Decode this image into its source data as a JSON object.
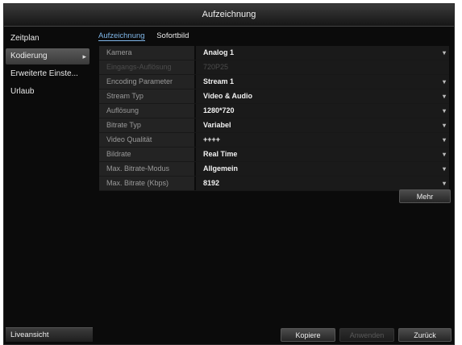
{
  "window": {
    "title": "Aufzeichnung"
  },
  "sidebar": {
    "items": [
      {
        "label": "Zeitplan",
        "active": false
      },
      {
        "label": "Kodierung",
        "active": true
      },
      {
        "label": "Erweiterte Einste...",
        "active": false
      },
      {
        "label": "Urlaub",
        "active": false
      }
    ],
    "live_view_label": "Liveansicht"
  },
  "tabs": [
    {
      "label": "Aufzeichnung",
      "active": true
    },
    {
      "label": "Sofortbild",
      "active": false
    }
  ],
  "settings": [
    {
      "label": "Kamera",
      "value": "Analog 1",
      "dropdown": true,
      "disabled": false
    },
    {
      "label": "Eingangs-Auflösung",
      "value": "720P25",
      "dropdown": false,
      "disabled": true
    },
    {
      "label": "Encoding Parameter",
      "value": "Stream 1",
      "dropdown": true,
      "disabled": false
    },
    {
      "label": "Stream Typ",
      "value": "Video & Audio",
      "dropdown": true,
      "disabled": false
    },
    {
      "label": "Auflösung",
      "value": "1280*720",
      "dropdown": true,
      "disabled": false
    },
    {
      "label": "Bitrate Typ",
      "value": "Variabel",
      "dropdown": true,
      "disabled": false
    },
    {
      "label": "Video Qualität",
      "value": "++++",
      "dropdown": true,
      "disabled": false
    },
    {
      "label": "Bildrate",
      "value": "Real Time",
      "dropdown": true,
      "disabled": false
    },
    {
      "label": "Max. Bitrate-Modus",
      "value": "Allgemein",
      "dropdown": true,
      "disabled": false
    },
    {
      "label": "Max. Bitrate (Kbps)",
      "value": "8192",
      "dropdown": true,
      "disabled": false
    }
  ],
  "buttons": {
    "more": "Mehr",
    "copy": "Kopiere",
    "apply": "Anwenden",
    "back": "Zurück"
  },
  "icons": {
    "dropdown": "chevron-down-icon",
    "active_item": "chevron-right-icon"
  },
  "colors": {
    "accent": "#7fb6e8",
    "background": "#0b0b0b"
  }
}
